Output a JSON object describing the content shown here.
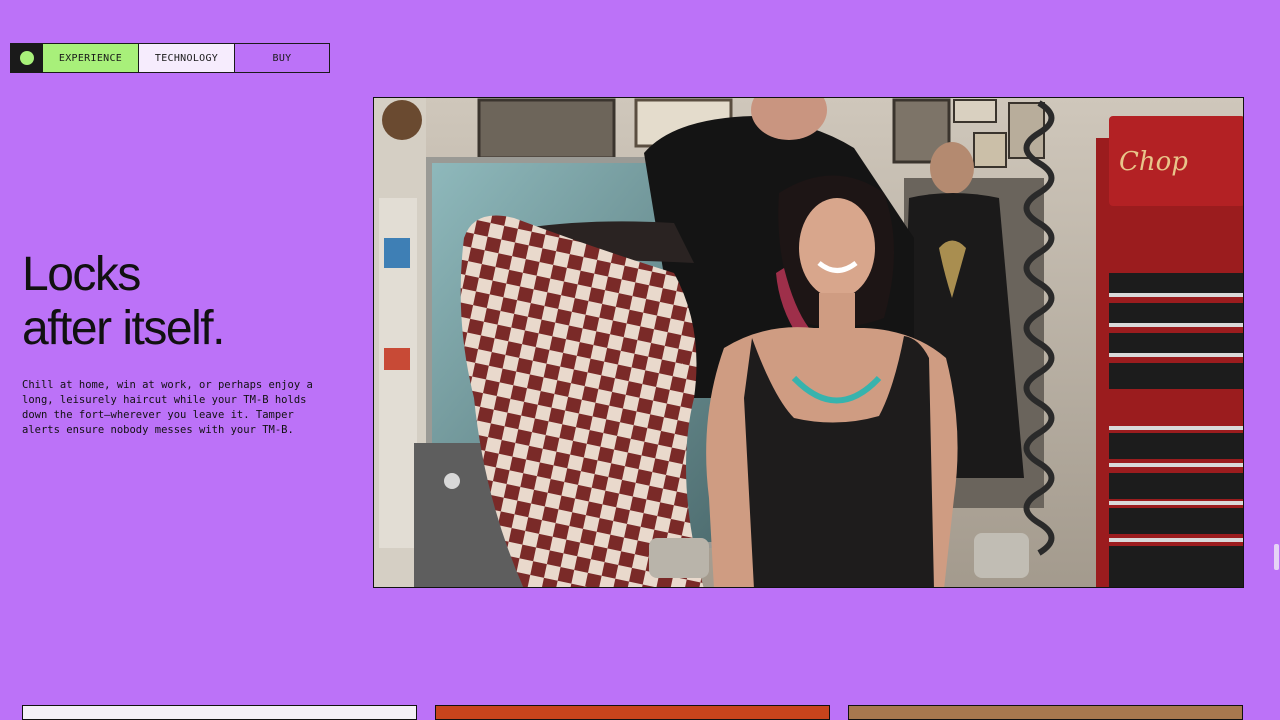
{
  "nav": {
    "tabs": [
      {
        "label": "EXPERIENCE"
      },
      {
        "label": "TECHNOLOGY"
      },
      {
        "label": "BUY"
      }
    ]
  },
  "hero": {
    "headline_line1": "Locks",
    "headline_line2": "after itself.",
    "body": "Chill at home, win at work, or perhaps enjoy a long, leisurely haircut while your TM-B holds down the fort—wherever you leave it. Tamper alerts ensure nobody messes with your TM-B."
  },
  "video": {
    "sign_text": "Chop"
  },
  "colors": {
    "background": "#bc72f8",
    "accent_green": "#a8f07a",
    "ink": "#111111"
  }
}
